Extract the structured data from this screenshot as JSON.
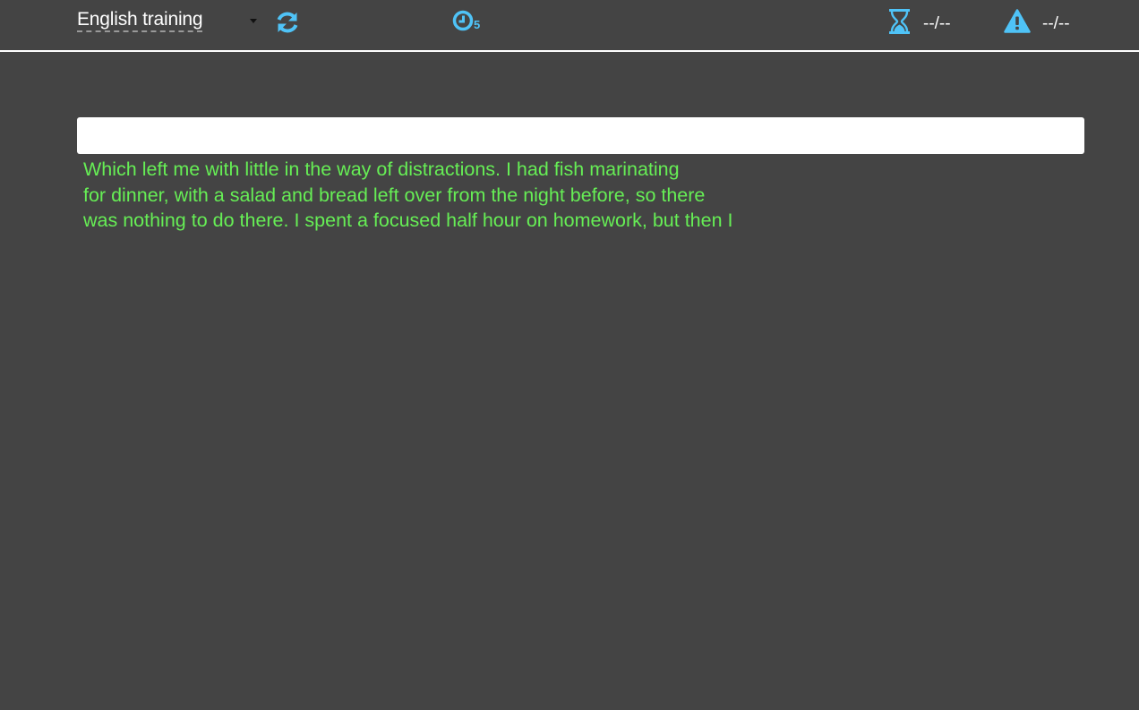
{
  "toolbar": {
    "mode_label": "English training",
    "icons": {
      "refresh": "refresh-icon",
      "clock": "clock-icon",
      "hourglass": "hourglass-icon",
      "warning": "warning-icon"
    },
    "clock_count": "5",
    "hourglass_value": "--/--",
    "warning_value": "--/--"
  },
  "input": {
    "value": "",
    "placeholder": ""
  },
  "passage": {
    "lines": [
      "Which left me with little in the way of distractions. I had fish marinating",
      "for dinner, with a salad and bread left over from the night before, so there",
      "was nothing to do there. I spent a focused half hour on homework, but then I"
    ]
  },
  "colors": {
    "background": "#444444",
    "accent": "#4fc3f7",
    "passage_text": "#66ee55",
    "header_text": "#ffffff"
  }
}
